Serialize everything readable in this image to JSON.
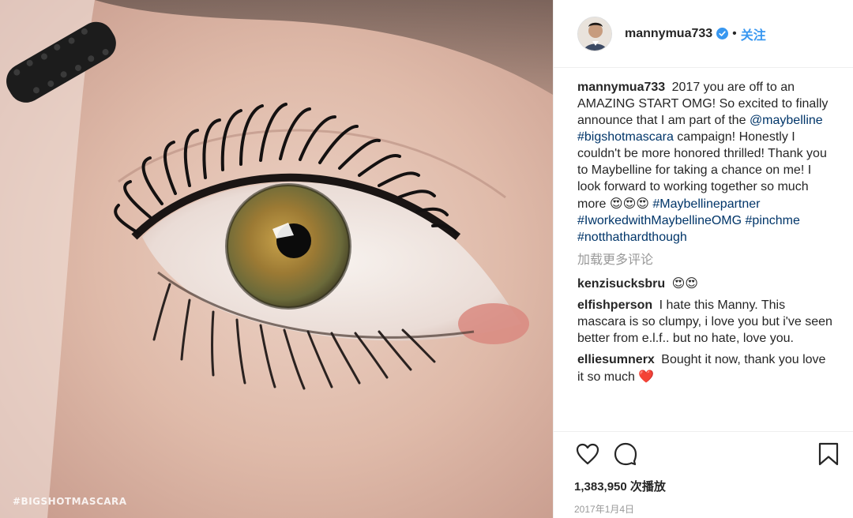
{
  "photo": {
    "watermark": "#BIGSHOTMASCARA"
  },
  "header": {
    "username": "mannymua733",
    "separator": "•",
    "follow_label": "关注"
  },
  "caption": {
    "username": "mannymua733",
    "text_1": "2017 you are off to an AMAZING START OMG! So excited to finally announce that I am part of the",
    "mention": "@maybelline",
    "tag_1": "#bigshotmascara",
    "text_2": "campaign! Honestly I couldn't be more honored thrilled! Thank you to Maybelline for taking a chance on me! I look forward to working together so much more",
    "emojis": "😍😍😍",
    "tag_2": "#Maybellinepartner",
    "tag_3": "#IworkedwithMaybellineOMG",
    "tag_4": "#pinchme",
    "tag_5": "#notthathardthough"
  },
  "load_more": "加载更多评论",
  "comments": [
    {
      "username": "kenzisucksbru",
      "text": "😍😍"
    },
    {
      "username": "elfishperson",
      "text": "I hate this Manny. This mascara is so clumpy, i love you but i've seen better from e.l.f.. but no hate, love you."
    },
    {
      "username": "elliesumnerx",
      "text": "Bought it now, thank you love it so much",
      "emoji": "❤️"
    }
  ],
  "footer": {
    "views": "1,383,950 次播放",
    "date": "2017年1月4日"
  },
  "icons": {
    "like": "heart-icon",
    "comment": "comment-bubble-icon",
    "save": "bookmark-icon",
    "verified": "verified-badge-icon"
  },
  "colors": {
    "link": "#003569",
    "follow": "#3897f0",
    "verified": "#3897f0",
    "muted": "#999999",
    "heart_red": "#e0245e"
  }
}
